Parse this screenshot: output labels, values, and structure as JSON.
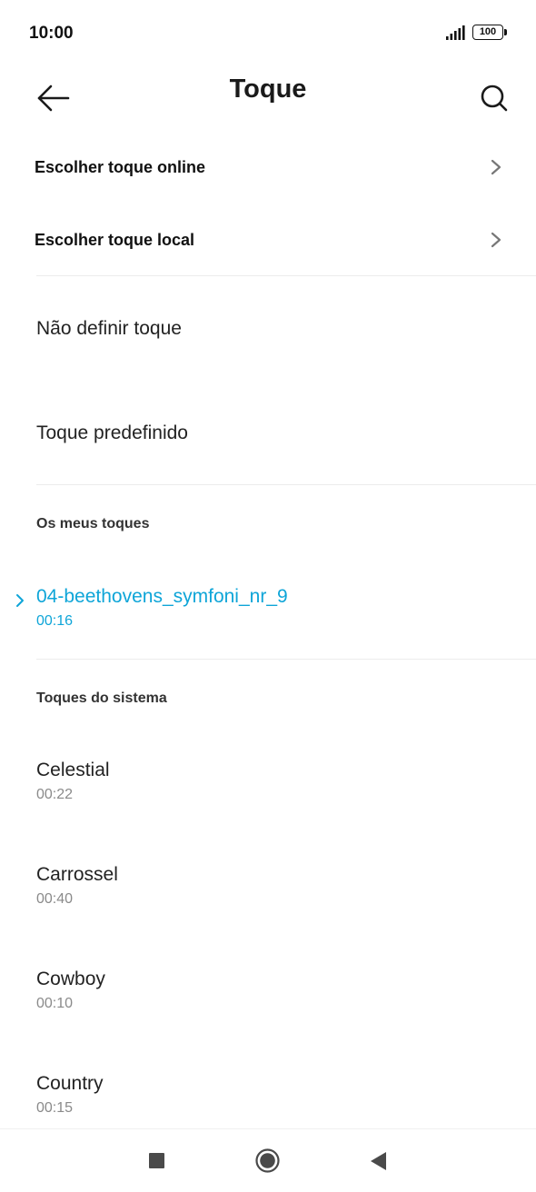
{
  "status_bar": {
    "time": "10:00",
    "battery": "100",
    "signal_icon": "signal-icon",
    "battery_icon": "battery-icon"
  },
  "header": {
    "title": "Toque",
    "back_icon": "arrow-left-icon",
    "search_icon": "search-icon"
  },
  "nav_items": [
    {
      "label": "Escolher toque online",
      "icon": "chevron-right-icon"
    },
    {
      "label": "Escolher toque local",
      "icon": "chevron-right-icon"
    }
  ],
  "options": [
    {
      "label": "Não definir toque"
    },
    {
      "label": "Toque predefinido"
    }
  ],
  "my_tones": {
    "header": "Os meus toques",
    "items": [
      {
        "name": "04-beethovens_symfoni_nr_9",
        "duration": "00:16",
        "selected": true
      }
    ]
  },
  "system_tones": {
    "header": "Toques do sistema",
    "items": [
      {
        "name": "Celestial",
        "duration": "00:22"
      },
      {
        "name": "Carrossel",
        "duration": "00:40"
      },
      {
        "name": "Cowboy",
        "duration": "00:10"
      },
      {
        "name": "Country",
        "duration": "00:15"
      }
    ]
  },
  "colors": {
    "accent": "#0ea5d8",
    "text_primary": "#222222",
    "text_secondary": "#8a8a8a",
    "divider": "#ececec"
  },
  "nav_bar": {
    "recents_icon": "square-icon",
    "home_icon": "circle-home-icon",
    "back_icon": "triangle-back-icon"
  }
}
